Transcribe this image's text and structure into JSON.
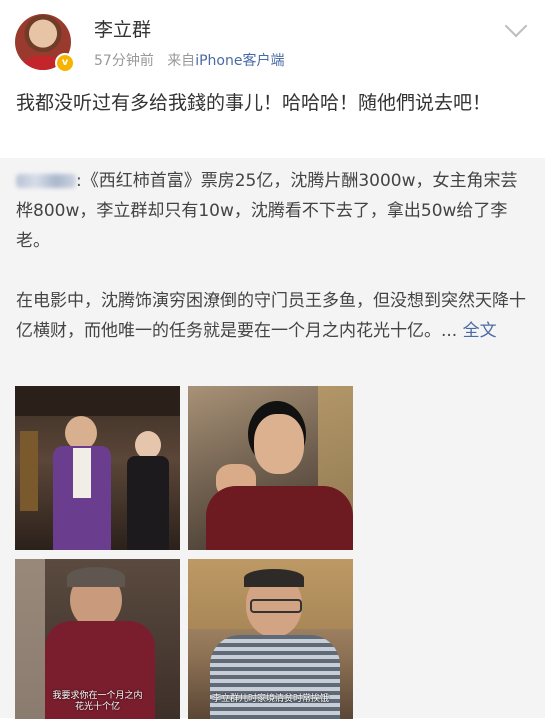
{
  "user": {
    "name": "李立群",
    "time": "57分钟前",
    "source_prefix": "来自",
    "source": "iPhone客户端",
    "verified_badge": "v"
  },
  "post": {
    "text": "我都没听过有多给我錢的事儿！哈哈哈！随他們说去吧！"
  },
  "repost": {
    "line1_rest": ":《西红柿首富》票房25亿，沈腾片酬3000w，女主角宋芸桦800w，李立群却只有10w，沈腾看不下去了，拿出50w给了李老。",
    "para2": "在电影中，沈腾饰演穷困潦倒的守门员王多鱼，但没想到突然天降十亿横财，而他唯一的任务就是要在一个月之内花光十亿。...",
    "full_text_link": "全文"
  },
  "images": [
    {
      "name": "photo-1",
      "caption": ""
    },
    {
      "name": "photo-2",
      "caption": ""
    },
    {
      "name": "photo-3",
      "caption": "我要求你在一个月之内\n花光十个亿"
    },
    {
      "name": "photo-4",
      "caption": "李立群儿时家境清贫时常挨饿"
    }
  ],
  "colors": {
    "link": "#4a6aa5",
    "meta": "#999999",
    "repost_bg": "#f4f4f4",
    "badge": "#f6b400"
  }
}
